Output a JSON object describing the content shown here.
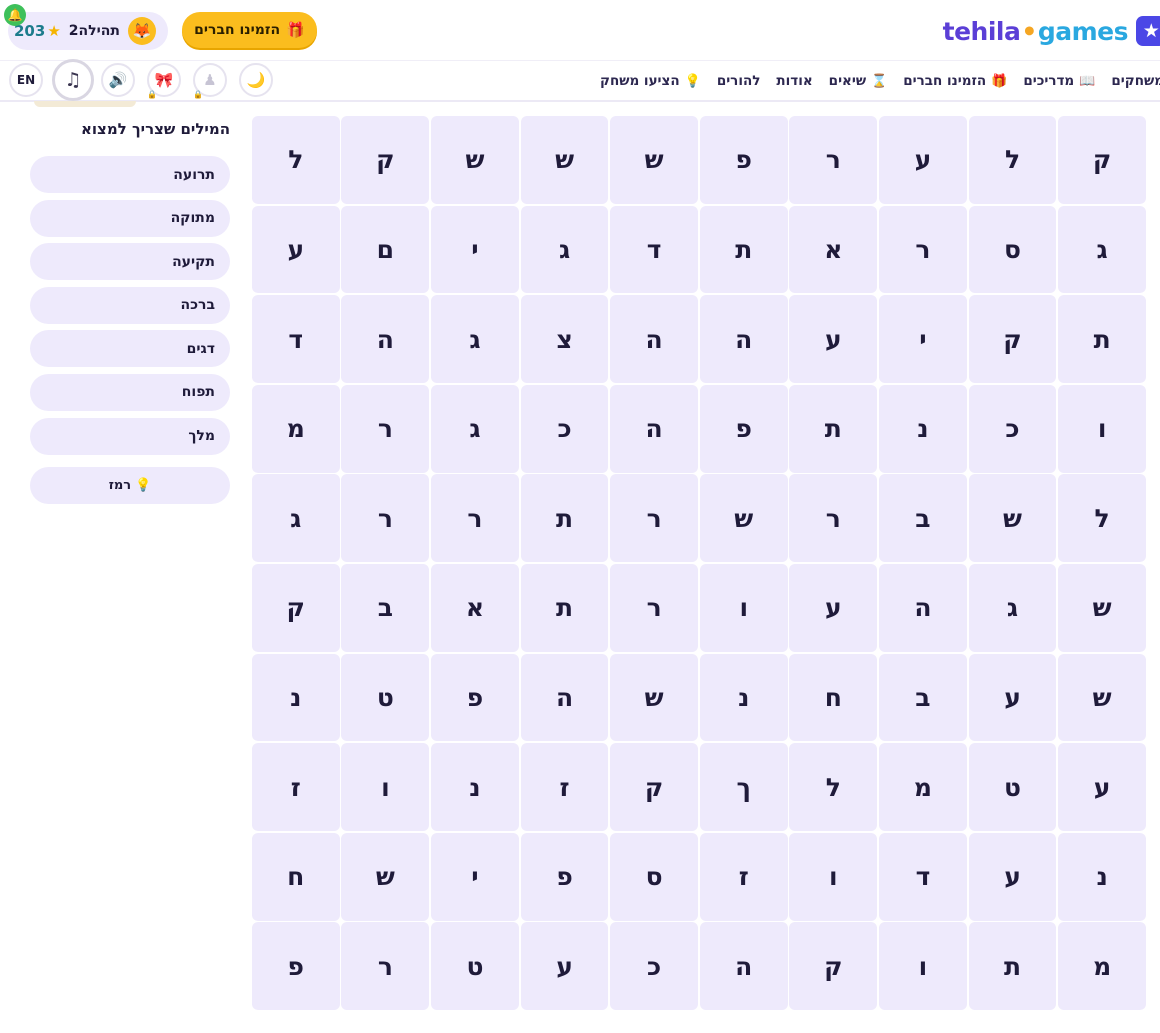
{
  "header": {
    "logo_part1": "tehila",
    "logo_dot": "•",
    "logo_part2": "games",
    "logo_mark": "★",
    "invite_label": "הזמינו חברים",
    "invite_icon": "🎁",
    "user": {
      "score": "203",
      "star": "★",
      "name": "תהילה2",
      "avatar": "🦊"
    },
    "bell_icon": "🔔"
  },
  "nav": {
    "items": [
      {
        "label": "משחקים",
        "icon": ""
      },
      {
        "label": "מדריכים",
        "icon": "📖"
      },
      {
        "label": "הזמינו חברים",
        "icon": "🎁"
      },
      {
        "label": "שיאים",
        "icon": "⌛"
      },
      {
        "label": "אודות",
        "icon": ""
      },
      {
        "label": "להורים",
        "icon": ""
      },
      {
        "label": "הציעו משחק",
        "icon": "💡"
      }
    ]
  },
  "controls": {
    "lang_label": "EN",
    "music_icon": "♫",
    "sound_icon": "🔊",
    "bow_icon": "🎀",
    "figure_icon": "♟",
    "moon_icon": "🌙",
    "lock_icon": "🔒"
  },
  "words": {
    "title": "המילים שצריך למצוא",
    "list": [
      "תרועה",
      "מתוקה",
      "תקיעה",
      "ברכה",
      "דגים",
      "תפוח",
      "מלך"
    ],
    "hint_label": "רמז",
    "hint_icon": "💡"
  },
  "grid": [
    [
      "ק",
      "ל",
      "ע",
      "ר",
      "פ",
      "ש",
      "ש",
      "ש",
      "ק",
      "ל"
    ],
    [
      "ג",
      "ס",
      "ר",
      "א",
      "ת",
      "ד",
      "ג",
      "י",
      "ם",
      "ע"
    ],
    [
      "ת",
      "ק",
      "י",
      "ע",
      "ה",
      "ה",
      "צ",
      "ג",
      "ה",
      "ד"
    ],
    [
      "ו",
      "כ",
      "נ",
      "ת",
      "פ",
      "ה",
      "כ",
      "ג",
      "ר",
      "מ"
    ],
    [
      "ל",
      "ש",
      "ב",
      "ר",
      "ש",
      "ר",
      "ת",
      "ר",
      "ר",
      "ג"
    ],
    [
      "ש",
      "ג",
      "ה",
      "ע",
      "ו",
      "ר",
      "ת",
      "א",
      "ב",
      "ק"
    ],
    [
      "ש",
      "ע",
      "ב",
      "ח",
      "נ",
      "ש",
      "ה",
      "פ",
      "ט",
      "נ"
    ],
    [
      "ע",
      "ט",
      "מ",
      "ל",
      "ך",
      "ק",
      "ז",
      "נ",
      "ו",
      "ז"
    ],
    [
      "נ",
      "ע",
      "ד",
      "ו",
      "ז",
      "ס",
      "פ",
      "י",
      "ש",
      "ח"
    ],
    [
      "מ",
      "ת",
      "ו",
      "ק",
      "ה",
      "כ",
      "ע",
      "ט",
      "ר",
      "פ"
    ]
  ]
}
